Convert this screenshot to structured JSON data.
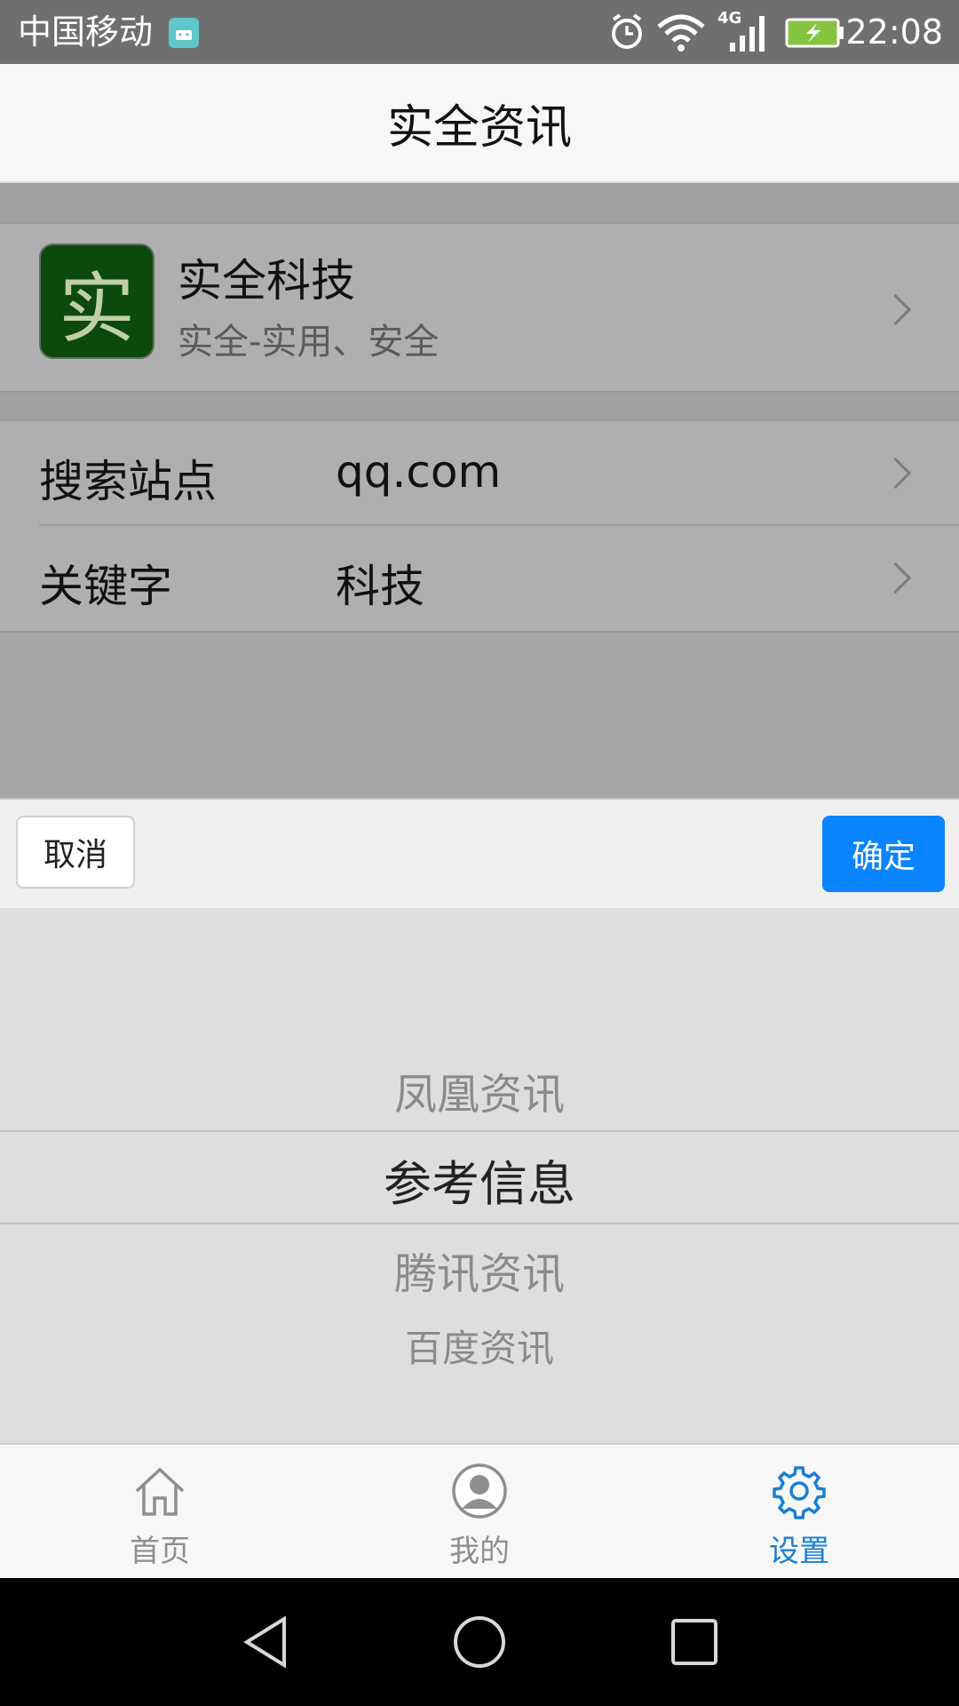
{
  "status_bar": {
    "carrier": "中国移动",
    "network": "4G",
    "time": "22:08"
  },
  "header": {
    "title": "实全资讯"
  },
  "company": {
    "logo_char": "实",
    "name": "实全科技",
    "slogan": "实全-实用、安全"
  },
  "settings": {
    "rows": [
      {
        "label": "搜索站点",
        "value": "qq.com"
      },
      {
        "label": "关键字",
        "value": "科技"
      }
    ]
  },
  "picker": {
    "cancel_label": "取消",
    "confirm_label": "确定",
    "options": [
      "凤凰资讯",
      "参考信息",
      "腾讯资讯",
      "百度资讯"
    ],
    "selected_index": 1
  },
  "tabbar": {
    "items": [
      {
        "label": "首页",
        "icon": "home-icon"
      },
      {
        "label": "我的",
        "icon": "user-icon"
      },
      {
        "label": "设置",
        "icon": "gear-icon"
      }
    ],
    "active_index": 2,
    "active_color": "#1a7fd4",
    "inactive_color": "#8e8e8e"
  },
  "colors": {
    "confirm_button": "#0a84ff",
    "logo_bg": "#0b4a0b",
    "status_bar": "#6f6f6f"
  }
}
